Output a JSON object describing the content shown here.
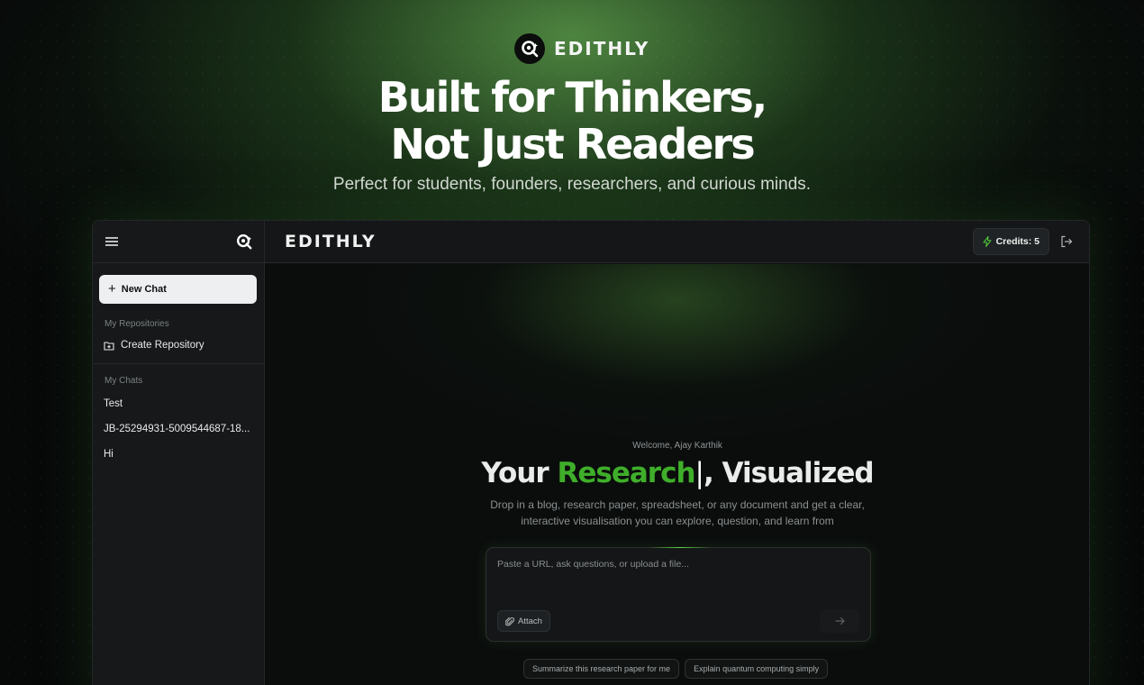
{
  "hero": {
    "brand": "EDITHLY",
    "headline_line1": "Built for Thinkers,",
    "headline_line2": "Not Just Readers",
    "subline": "Perfect for students, founders, researchers, and curious minds."
  },
  "sidebar": {
    "new_chat_label": "New Chat",
    "repositories_heading": "My Repositories",
    "create_repository_label": "Create Repository",
    "chats_heading": "My Chats",
    "chats": [
      "Test",
      "JB-25294931-5009544687-18...",
      "Hi"
    ]
  },
  "topbar": {
    "title": "EDITHLY",
    "credits_label": "Credits: 5"
  },
  "main": {
    "welcome": "Welcome, Ajay Karthik",
    "title_prefix": "Your ",
    "title_accent": "Research",
    "title_caret": "|",
    "title_suffix": ", Visualized",
    "description_line1": "Drop in a blog, research paper, spreadsheet, or any document and get a clear,",
    "description_line2": "interactive visualisation you can explore, question, and learn from",
    "prompt_placeholder": "Paste a URL, ask questions, or upload a file...",
    "attach_label": "Attach",
    "suggestions": [
      "Summarize this research paper for me",
      "Explain quantum computing simply"
    ]
  },
  "colors": {
    "accent_green": "#3fae2a",
    "credits_icon": "#4cc338",
    "background": "#07090a"
  },
  "icons": {
    "brand": "edithly-logo-icon",
    "menu": "hamburger-menu-icon",
    "folder": "folder-plus-icon",
    "credits": "lightning-bolt-icon",
    "logout": "logout-icon",
    "attach": "paperclip-icon",
    "send": "arrow-right-icon"
  }
}
